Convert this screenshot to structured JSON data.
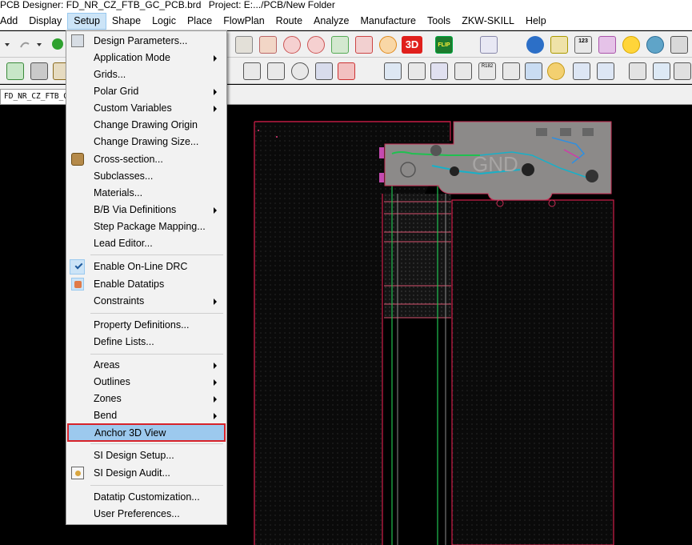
{
  "window": {
    "app_title": "PCB Designer: FD_NR_CZ_FTB_GC_PCB.brd",
    "project": "Project: E:.../PCB/New Folder"
  },
  "menubar": {
    "items": [
      "Add",
      "Display",
      "Setup",
      "Shape",
      "Logic",
      "Place",
      "FlowPlan",
      "Route",
      "Analyze",
      "Manufacture",
      "Tools",
      "ZKW-SKILL",
      "Help"
    ],
    "active": "Setup"
  },
  "toolbar": {
    "flip_label": "FLIP",
    "threed_label": "3D",
    "counter_label": "123",
    "ref_label": "R182"
  },
  "tab": {
    "document": "FD_NR_CZ_FTB_GC_PCB"
  },
  "setup_menu": {
    "items": [
      {
        "label": "Design Parameters...",
        "submenu": false
      },
      {
        "label": "Application Mode",
        "submenu": true
      },
      {
        "label": "Grids...",
        "submenu": false
      },
      {
        "label": "Polar Grid",
        "submenu": true
      },
      {
        "label": "Custom Variables",
        "submenu": true
      },
      {
        "label": "Change Drawing Origin",
        "submenu": false
      },
      {
        "label": "Change Drawing Size...",
        "submenu": false
      },
      {
        "label": "Cross-section...",
        "submenu": false,
        "icon": "cross-section-icon"
      },
      {
        "label": "Subclasses...",
        "submenu": false
      },
      {
        "label": "Materials...",
        "submenu": false
      },
      {
        "label": "B/B Via Definitions",
        "submenu": true
      },
      {
        "label": "Step Package Mapping...",
        "submenu": false
      },
      {
        "label": "Lead Editor...",
        "submenu": false
      },
      {
        "label": "Enable On-Line DRC",
        "submenu": false,
        "checked": true
      },
      {
        "label": "Enable Datatips",
        "submenu": false,
        "icon": "datatips-icon"
      },
      {
        "label": "Constraints",
        "submenu": true
      },
      {
        "label": "Property Definitions...",
        "submenu": false
      },
      {
        "label": "Define Lists...",
        "submenu": false
      },
      {
        "label": "Areas",
        "submenu": true
      },
      {
        "label": "Outlines",
        "submenu": true
      },
      {
        "label": "Zones",
        "submenu": true
      },
      {
        "label": "Bend",
        "submenu": true
      },
      {
        "label": "Anchor 3D View",
        "submenu": false,
        "highlighted": true
      },
      {
        "label": "SI Design Setup...",
        "submenu": false
      },
      {
        "label": "SI Design Audit...",
        "submenu": false,
        "icon": "audit-icon"
      },
      {
        "label": "Datatip Customization...",
        "submenu": false
      },
      {
        "label": "User Preferences...",
        "submenu": false
      }
    ]
  },
  "canvas": {
    "board_text": "GND"
  },
  "colors": {
    "menu_highlight": "#9cc9ee",
    "callout_red": "#d8232a",
    "board_outline": "#d01f4a",
    "copper": "#8c8a89",
    "trace_green": "#20c050",
    "trace_cyan": "#18b0c8"
  }
}
